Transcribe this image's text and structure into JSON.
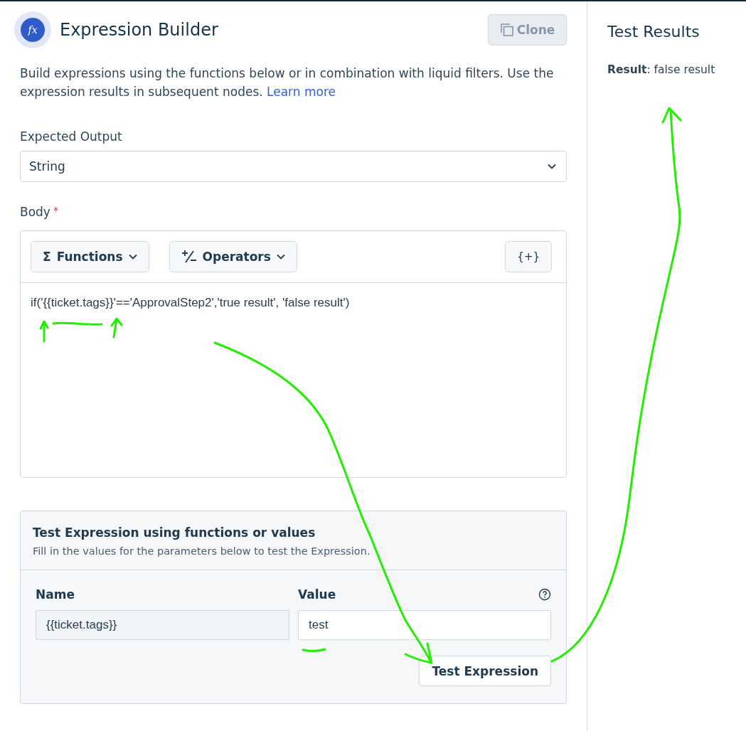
{
  "header": {
    "icon_label": "fx",
    "title": "Expression Builder",
    "clone_button": {
      "label": "Clone",
      "disabled": true
    }
  },
  "description": {
    "text": "Build expressions using the functions below or in combination with liquid filters. Use the expression results in subsequent nodes.",
    "link": "Learn more"
  },
  "expected_output": {
    "label": "Expected Output",
    "value": "String"
  },
  "body": {
    "label": "Body",
    "required": true,
    "required_mark": "*",
    "toolbar": [
      {
        "kind": "glyph",
        "icon": "Σ",
        "label": "Functions"
      },
      {
        "kind": "plusminus",
        "label": "Operators"
      }
    ],
    "insert_button": "{+}",
    "expression": "if('{{ticket.tags}}'=='ApprovalStep2','true result', 'false result')"
  },
  "test": {
    "title": "Test Expression using functions or values",
    "subtitle": "Fill in the values for the parameters below to test the Expression.",
    "columns": [
      "Name",
      "Value"
    ],
    "params": [
      {
        "name": "{{ticket.tags}}",
        "value": "test"
      }
    ],
    "button": "Test Expression"
  },
  "results": {
    "title": "Test Results",
    "text": "**Result**: false result"
  }
}
